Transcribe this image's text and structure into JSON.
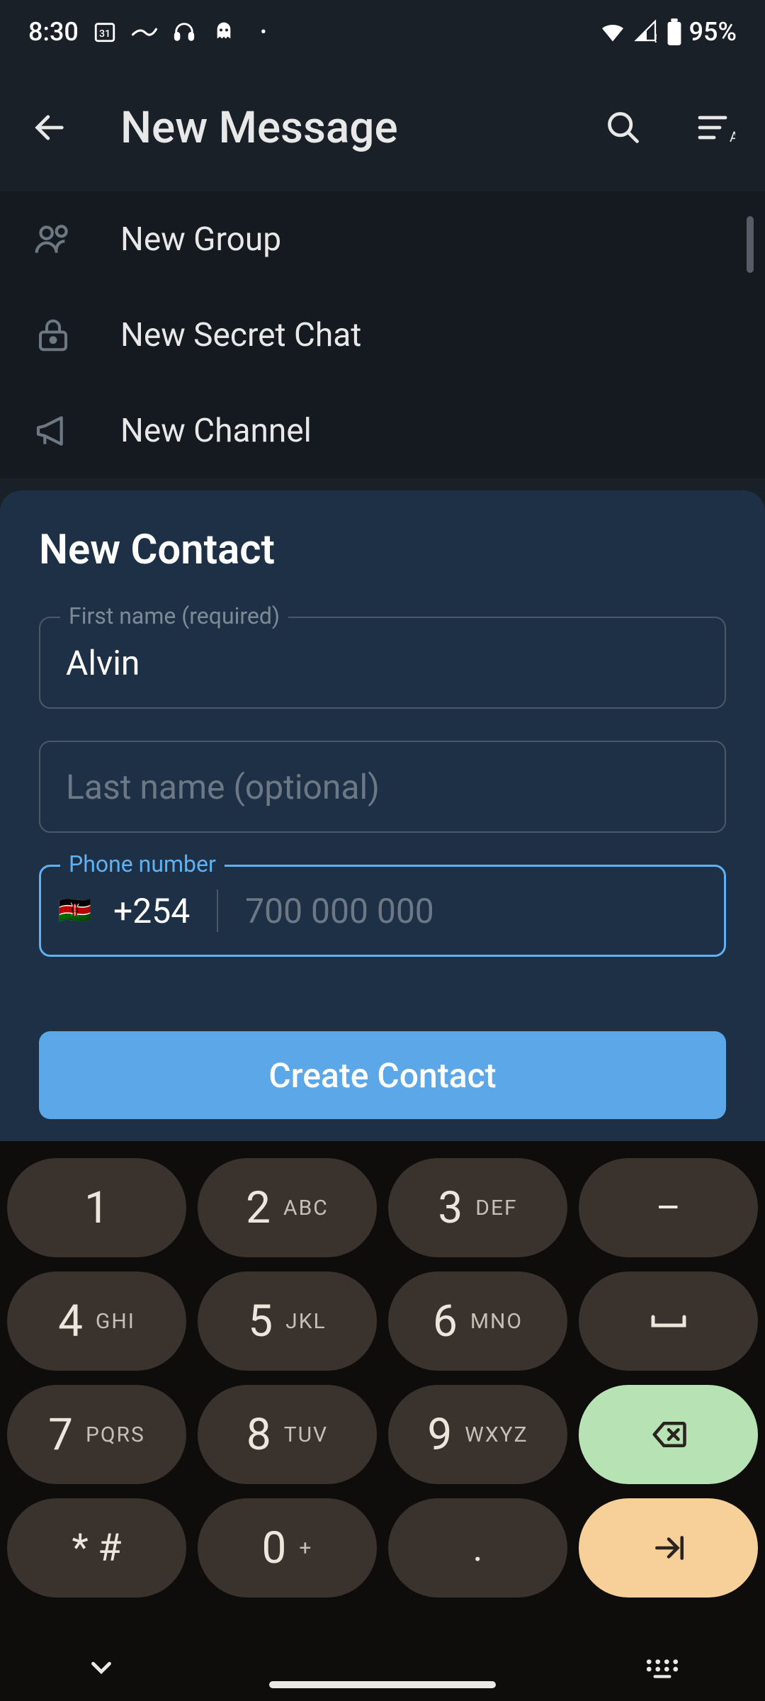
{
  "status": {
    "time": "8:30",
    "battery": "95%"
  },
  "header": {
    "title": "New Message"
  },
  "options": {
    "new_group": "New Group",
    "new_secret_chat": "New Secret Chat",
    "new_channel": "New Channel"
  },
  "contact": {
    "heading": "New Contact",
    "first_name_label": "First name (required)",
    "first_name_value": "Alvin",
    "last_name_placeholder": "Last name (optional)",
    "last_name_value": "",
    "phone_label": "Phone number",
    "country_code": "+254",
    "phone_placeholder": "700 000 000",
    "phone_value": "",
    "flag": "🇰🇪",
    "create_button": "Create Contact"
  },
  "keypad": {
    "rows": [
      [
        {
          "n": "1",
          "l": ""
        },
        {
          "n": "2",
          "l": "ABC"
        },
        {
          "n": "3",
          "l": "DEF"
        },
        {
          "sym": "–"
        }
      ],
      [
        {
          "n": "4",
          "l": "GHI"
        },
        {
          "n": "5",
          "l": "JKL"
        },
        {
          "n": "6",
          "l": "MNO"
        },
        {
          "sym": "␣"
        }
      ],
      [
        {
          "n": "7",
          "l": "PQRS"
        },
        {
          "n": "8",
          "l": "TUV"
        },
        {
          "n": "9",
          "l": "WXYZ"
        },
        {
          "action": "backspace"
        }
      ],
      [
        {
          "sym": "* #"
        },
        {
          "n": "0",
          "l": "+"
        },
        {
          "sym": "."
        },
        {
          "action": "enter"
        }
      ]
    ]
  }
}
